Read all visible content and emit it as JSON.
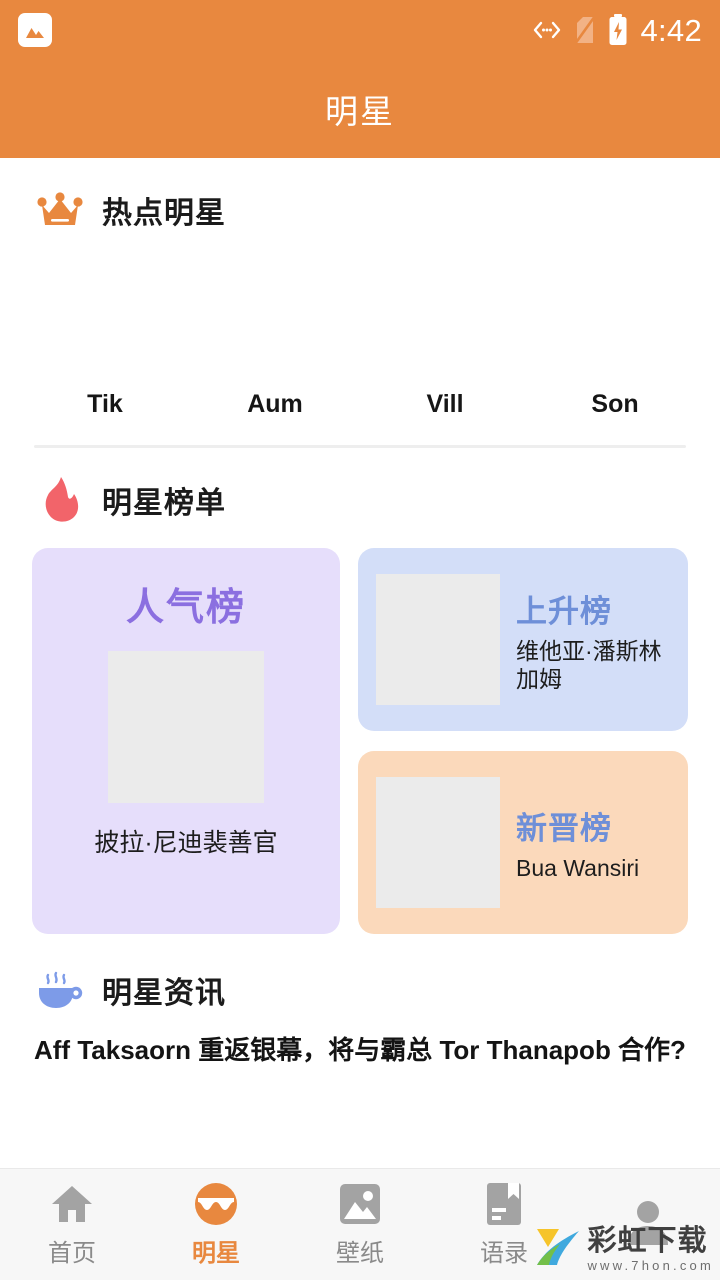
{
  "status_bar": {
    "notification_icon": "gallery-image-icon",
    "cast_icon": "cast-icon",
    "sim_icon": "no-sim-icon",
    "battery_icon": "battery-charging-icon",
    "time": "4:42"
  },
  "app_bar": {
    "title": "明星"
  },
  "colors": {
    "brand_orange": "#E8883F",
    "popularity_card_bg": "#E6DEFB",
    "popularity_title": "#8B6FE0",
    "rising_card_bg": "#D3DEF8",
    "rising_title": "#6E8FD8",
    "new_card_bg": "#FBD9BB",
    "new_title": "#6E8FD8",
    "flame_red": "#F2646A",
    "coffee_blue": "#7D9BE8",
    "placeholder_gray": "#EBEBEB"
  },
  "hot_stars": {
    "icon": "crown-icon",
    "title": "热点明星",
    "items": [
      {
        "name": "Tik",
        "avatar": "star-avatar-placeholder"
      },
      {
        "name": "Aum",
        "avatar": "star-avatar-placeholder"
      },
      {
        "name": "Vill",
        "avatar": "star-avatar-placeholder"
      },
      {
        "name": "Son",
        "avatar": "star-avatar-placeholder"
      }
    ]
  },
  "rankings": {
    "icon": "flame-icon",
    "title": "明星榜单",
    "popularity": {
      "title": "人气榜",
      "star_name": "披拉·尼迪裴善官",
      "thumb": "rank-thumb-placeholder"
    },
    "rising": {
      "title": "上升榜",
      "star_name": "维他亚·潘斯林加姆",
      "thumb": "rank-thumb-placeholder"
    },
    "newcomers": {
      "title": "新晋榜",
      "star_name": "Bua Wansiri",
      "thumb": "rank-thumb-placeholder"
    }
  },
  "news": {
    "icon": "coffee-cup-icon",
    "title": "明星资讯",
    "items": [
      {
        "headline": "Aff Taksaorn 重返银幕，将与霸总 Tor Thanapob 合作?"
      }
    ]
  },
  "bottom_nav": {
    "items": [
      {
        "label": "首页",
        "icon": "home-icon",
        "active": false
      },
      {
        "label": "明星",
        "icon": "star-wave-icon",
        "active": true
      },
      {
        "label": "壁纸",
        "icon": "wallpaper-image-icon",
        "active": false
      },
      {
        "label": "语录",
        "icon": "bookmark-book-icon",
        "active": false
      },
      {
        "label": "",
        "icon": "user-profile-icon",
        "active": false
      }
    ]
  },
  "watermark": {
    "name": "彩虹下载",
    "url": "www.7hon.com",
    "logo": "rainbow-download-logo"
  }
}
